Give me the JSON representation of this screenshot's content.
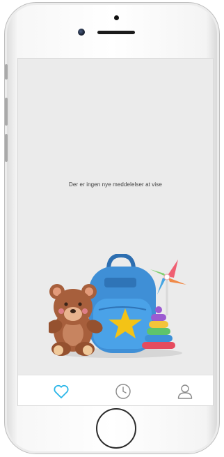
{
  "screen": {
    "empty_message": "Der er ingen nye meddelelser at vise"
  },
  "tabbar": {
    "tabs": [
      {
        "icon": "heart-icon",
        "active": true
      },
      {
        "icon": "clock-icon",
        "active": false
      },
      {
        "icon": "user-icon",
        "active": false
      }
    ],
    "active_color": "#29b6e8",
    "inactive_color": "#8a8a8a"
  },
  "illustration": {
    "items": [
      "teddy-bear",
      "backpack",
      "star",
      "pinwheel",
      "ring-stack-toy"
    ]
  }
}
